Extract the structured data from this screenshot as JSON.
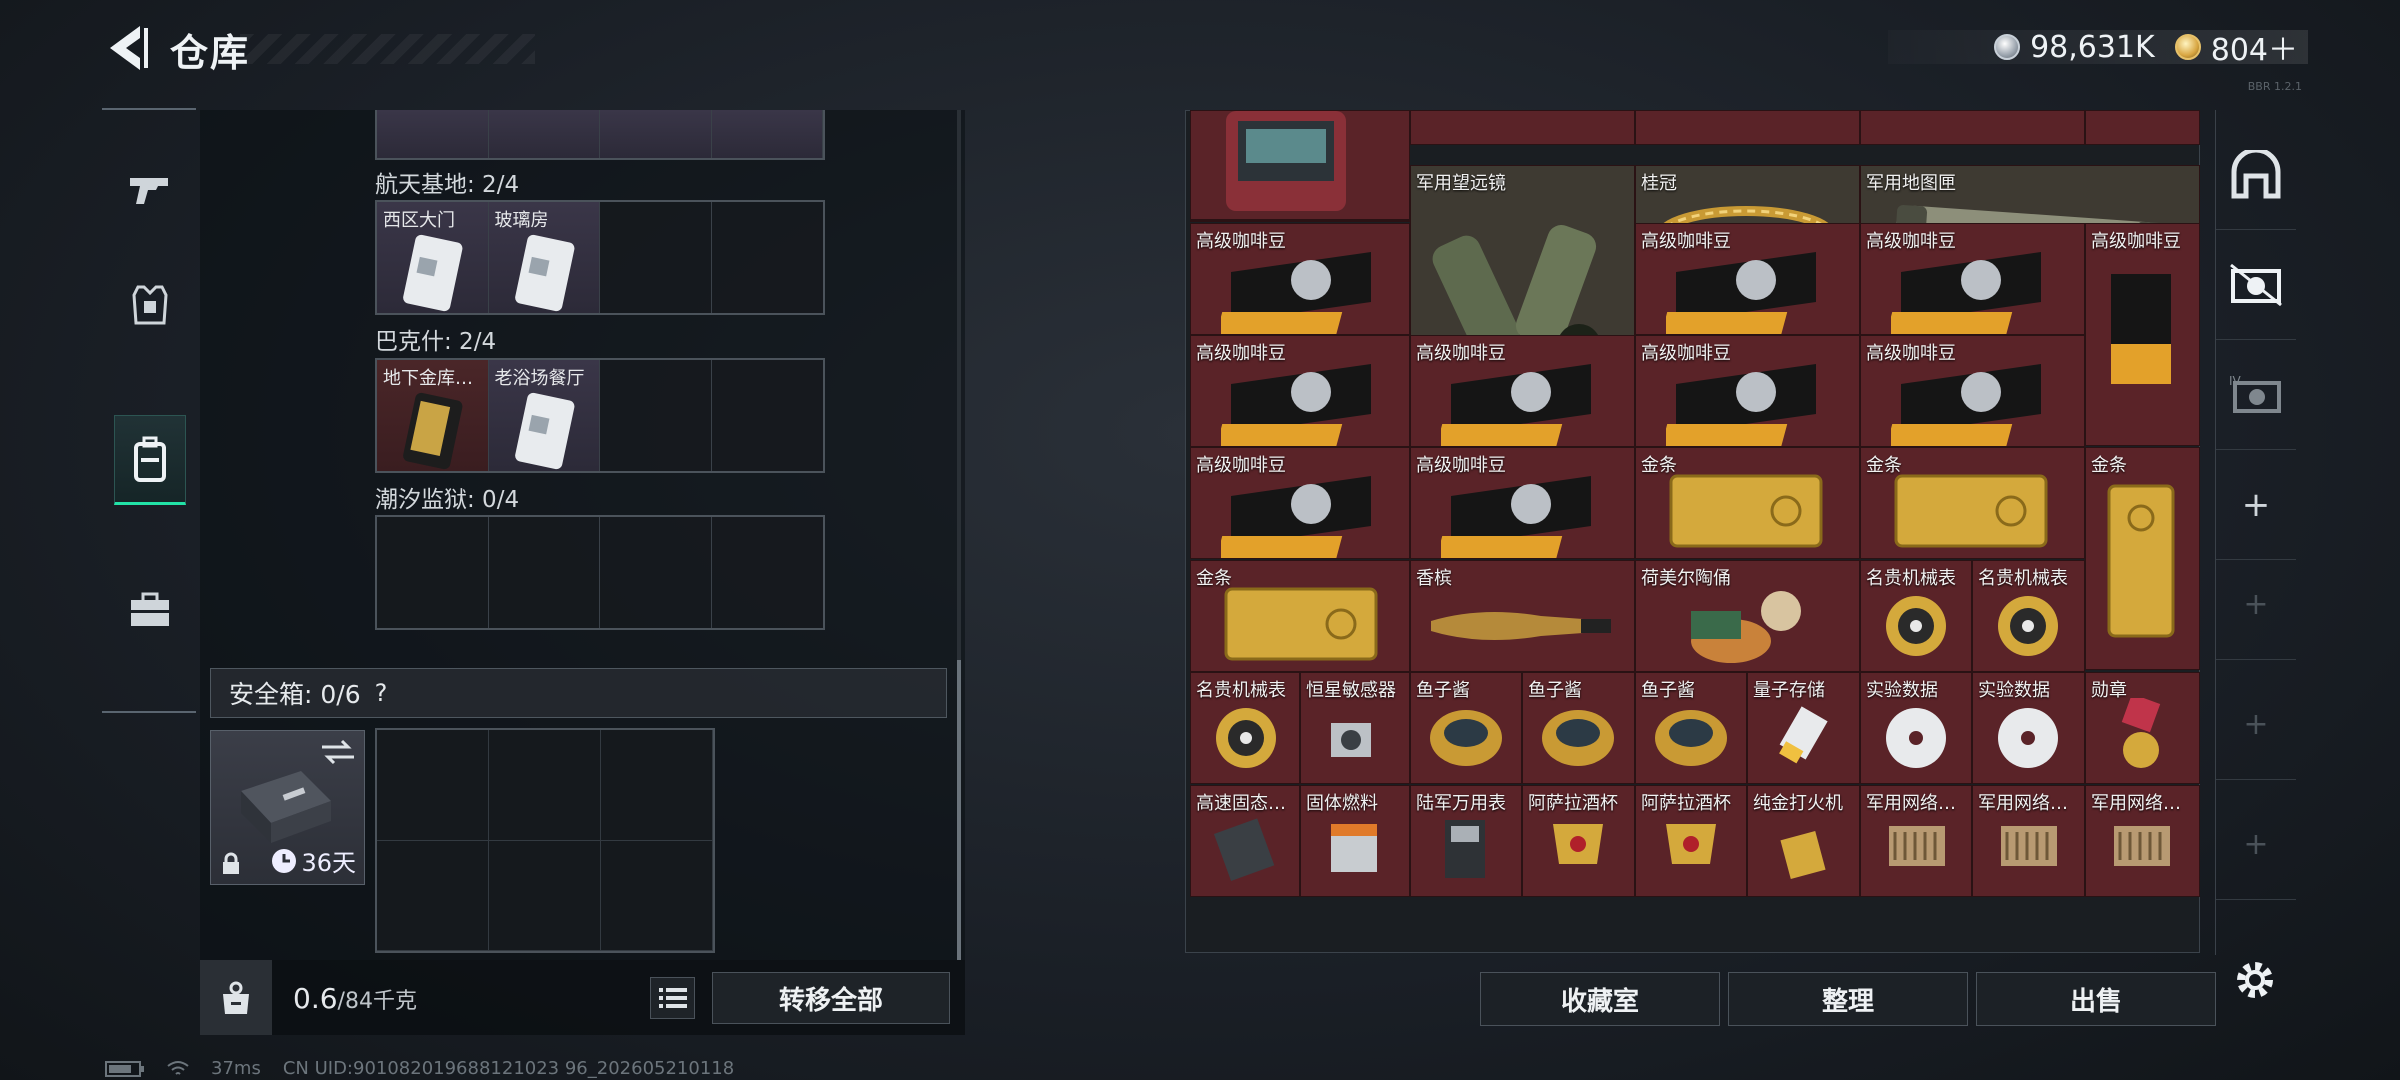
{
  "header": {
    "title": "仓库",
    "currency_silver": "98,631K",
    "currency_gold": "804＋"
  },
  "left_nav": [
    "gun-icon",
    "armor-icon",
    "backpack-icon",
    "briefcase-icon"
  ],
  "stash": {
    "sections": [
      {
        "name": "航天基地: 2/4",
        "slots": [
          "西区大门",
          "玻璃房",
          "",
          ""
        ]
      },
      {
        "name": "巴克什: 2/4",
        "slots": [
          "地下金库…",
          "老浴场餐厅",
          "",
          ""
        ]
      },
      {
        "name": "潮汐监狱: 0/4",
        "slots": [
          "",
          "",
          "",
          ""
        ]
      }
    ],
    "safe_title": "安全箱: 0/6",
    "safe_help": "?",
    "safe_days": "36天",
    "weight_value": "0.6",
    "weight_max": "/84千克",
    "transfer_all": "转移全部"
  },
  "inventory": {
    "items": {
      "telescope": "军用望远镜",
      "crown": "桂冠",
      "map_tube": "军用地图匣",
      "coffee": "高级咖啡豆",
      "gold_bar": "金条",
      "champagne": "香槟",
      "figurine": "荷美尔陶俑",
      "watch": "名贵机械表",
      "sensor": "恒星敏感器",
      "caviar": "鱼子酱",
      "quantum": "量子存储",
      "disc": "实验数据",
      "medal": "勋章",
      "ssd": "高速固态…",
      "fuel": "固体燃料",
      "army_watch": "陆军万用表",
      "cup": "阿萨拉酒杯",
      "lighter": "纯金打火机",
      "network": "军用网络…"
    },
    "buttons": {
      "collection": "收藏室",
      "sort": "整理",
      "sell": "出售"
    }
  },
  "right_sidebar": [
    "vault-icon",
    "camera-icon",
    "camera-4-icon",
    "+",
    "+",
    "+",
    "+",
    "+"
  ],
  "status": {
    "ping": "37ms",
    "uid": "CN UID:901082019688121023 96_202605210118"
  },
  "version_text": "BBR 1.2.1",
  "colors": {
    "accent": "#22e3a7",
    "item_red": "#5a2328"
  }
}
